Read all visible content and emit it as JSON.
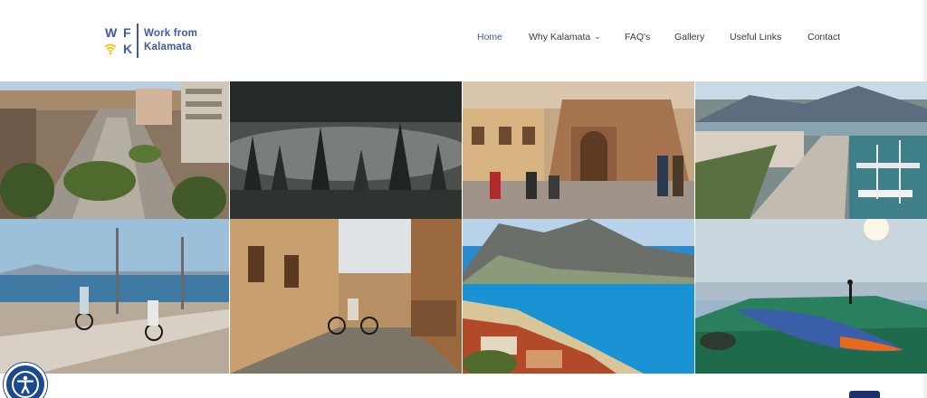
{
  "logo": {
    "letters": [
      "W",
      "F",
      "K"
    ],
    "line1": "Work from",
    "line2": "Kalamata",
    "brand_color": "#3e5aa8",
    "accent_color": "#f2c200"
  },
  "nav": {
    "items": [
      {
        "label": "Home",
        "active": true
      },
      {
        "label": "Why Kalamata",
        "dropdown": true
      },
      {
        "label": "FAQ's"
      },
      {
        "label": "Gallery"
      },
      {
        "label": "Useful Links"
      },
      {
        "label": "Contact"
      }
    ],
    "active_color": "#3e5aa8"
  },
  "gallery": {
    "photos": [
      {
        "subject": "aerial city boulevard"
      },
      {
        "subject": "misty pine forest"
      },
      {
        "subject": "old stone church square"
      },
      {
        "subject": "marina aerial view"
      },
      {
        "subject": "seafront cyclists promenade"
      },
      {
        "subject": "narrow shopping street cyclist"
      },
      {
        "subject": "bay coastline and mountains"
      },
      {
        "subject": "paraglider on mountain top"
      }
    ]
  },
  "icons": {
    "accessibility": "accessibility-icon",
    "wifi": "wifi-icon",
    "chevron": "chevron-down-icon"
  }
}
